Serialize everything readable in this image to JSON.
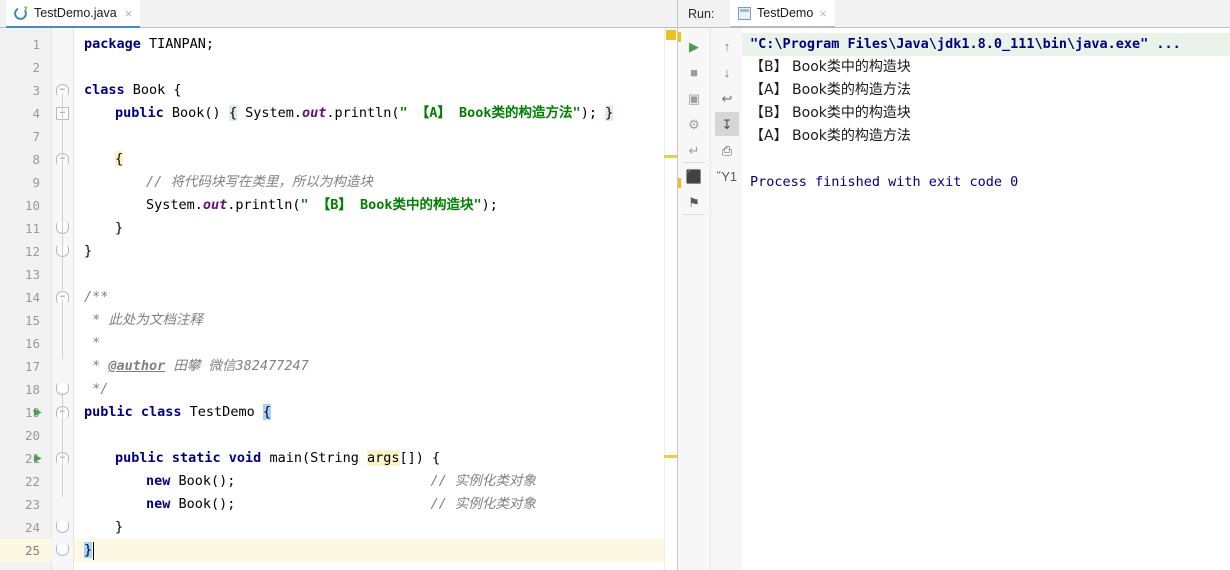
{
  "editor": {
    "tab": {
      "label": "TestDemo.java",
      "icon": "java-class-icon",
      "close": "×"
    },
    "lines": [
      {
        "num": "1",
        "indent": 0,
        "fold": "",
        "run": false,
        "tokens": [
          {
            "t": "package",
            "c": "kw"
          },
          {
            "t": " TIANPAN;",
            "c": "plain"
          }
        ]
      },
      {
        "num": "2",
        "indent": 0,
        "fold": "",
        "run": false,
        "tokens": []
      },
      {
        "num": "3",
        "indent": 0,
        "fold": "start",
        "run": false,
        "tokens": [
          {
            "t": "class",
            "c": "kw"
          },
          {
            "t": " Book ",
            "c": "plain"
          },
          {
            "t": "{",
            "c": "plain"
          }
        ]
      },
      {
        "num": "4",
        "indent": 1,
        "fold": "plus",
        "run": false,
        "tokens": [
          {
            "t": "public",
            "c": "kw"
          },
          {
            "t": " Book() ",
            "c": "plain"
          },
          {
            "t": "{",
            "c": "brhl"
          },
          {
            "t": " System.",
            "c": "plain"
          },
          {
            "t": "out",
            "c": "fld"
          },
          {
            "t": ".println(",
            "c": "plain"
          },
          {
            "t": "\" 【A】 Book类的构造方法\"",
            "c": "str"
          },
          {
            "t": "); ",
            "c": "plain"
          },
          {
            "t": "}",
            "c": "brhl"
          }
        ]
      },
      {
        "num": "7",
        "indent": 0,
        "fold": "",
        "run": false,
        "tokens": []
      },
      {
        "num": "8",
        "indent": 1,
        "fold": "start",
        "run": false,
        "tokens": [
          {
            "t": "{",
            "c": "argshl"
          }
        ]
      },
      {
        "num": "9",
        "indent": 2,
        "fold": "",
        "run": false,
        "tokens": [
          {
            "t": "// 将代码块写在类里，所以为构造块",
            "c": "cmt"
          }
        ]
      },
      {
        "num": "10",
        "indent": 2,
        "fold": "",
        "run": false,
        "tokens": [
          {
            "t": "System.",
            "c": "plain"
          },
          {
            "t": "out",
            "c": "fld"
          },
          {
            "t": ".println(",
            "c": "plain"
          },
          {
            "t": "\" 【B】 Book类中的构造块\"",
            "c": "str"
          },
          {
            "t": ");",
            "c": "plain"
          }
        ]
      },
      {
        "num": "11",
        "indent": 1,
        "fold": "end",
        "run": false,
        "tokens": [
          {
            "t": "}",
            "c": "plain"
          }
        ]
      },
      {
        "num": "12",
        "indent": 0,
        "fold": "end",
        "run": false,
        "tokens": [
          {
            "t": "}",
            "c": "plain"
          }
        ]
      },
      {
        "num": "13",
        "indent": 0,
        "fold": "",
        "run": false,
        "tokens": []
      },
      {
        "num": "14",
        "indent": 0,
        "fold": "start",
        "run": false,
        "tokens": [
          {
            "t": "/**",
            "c": "doc"
          }
        ]
      },
      {
        "num": "15",
        "indent": 0,
        "fold": "",
        "run": false,
        "tokens": [
          {
            "t": " * 此处为文档注释",
            "c": "doc"
          }
        ]
      },
      {
        "num": "16",
        "indent": 0,
        "fold": "",
        "run": false,
        "tokens": [
          {
            "t": " *",
            "c": "doc"
          }
        ]
      },
      {
        "num": "17",
        "indent": 0,
        "fold": "",
        "run": false,
        "tokens": [
          {
            "t": " * ",
            "c": "doc"
          },
          {
            "t": "@author",
            "c": "docTag"
          },
          {
            "t": " 田攀 微信382477247",
            "c": "doc"
          }
        ]
      },
      {
        "num": "18",
        "indent": 0,
        "fold": "end",
        "run": false,
        "tokens": [
          {
            "t": " */",
            "c": "doc"
          }
        ]
      },
      {
        "num": "19",
        "indent": 0,
        "fold": "start",
        "run": true,
        "tokens": [
          {
            "t": "public class",
            "c": "kw"
          },
          {
            "t": " TestDemo ",
            "c": "plain"
          },
          {
            "t": "{",
            "c": "selbr"
          }
        ]
      },
      {
        "num": "20",
        "indent": 0,
        "fold": "",
        "run": false,
        "tokens": []
      },
      {
        "num": "21",
        "indent": 1,
        "fold": "start",
        "run": true,
        "tokens": [
          {
            "t": "public static void",
            "c": "kw"
          },
          {
            "t": " main(String ",
            "c": "plain"
          },
          {
            "t": "args",
            "c": "argshl"
          },
          {
            "t": "[]) {",
            "c": "plain"
          }
        ]
      },
      {
        "num": "22",
        "indent": 2,
        "fold": "",
        "run": false,
        "tokens": [
          {
            "t": "new",
            "c": "kw"
          },
          {
            "t": " Book();",
            "c": "plain"
          },
          {
            "t": "                        ",
            "c": "plain"
          },
          {
            "t": "// 实例化类对象",
            "c": "cmt"
          }
        ]
      },
      {
        "num": "23",
        "indent": 2,
        "fold": "",
        "run": false,
        "tokens": [
          {
            "t": "new",
            "c": "kw"
          },
          {
            "t": " Book();",
            "c": "plain"
          },
          {
            "t": "                        ",
            "c": "plain"
          },
          {
            "t": "// 实例化类对象",
            "c": "cmt"
          }
        ]
      },
      {
        "num": "24",
        "indent": 1,
        "fold": "end",
        "run": false,
        "tokens": [
          {
            "t": "}",
            "c": "plain"
          }
        ]
      },
      {
        "num": "25",
        "indent": 0,
        "fold": "end",
        "run": false,
        "current": true,
        "tokens": [
          {
            "t": "}",
            "c": "selbr"
          }
        ]
      }
    ],
    "markers": {
      "top_color": "#f0c020",
      "stripe_color": "#e8cf4a",
      "stripes_y": [
        155,
        455
      ]
    }
  },
  "run_panel": {
    "title": "Run:",
    "tab": {
      "label": "TestDemo",
      "icon": "run-config-icon",
      "close": "×"
    },
    "toolbar_left": [
      {
        "name": "rerun-icon",
        "glyph": "▶",
        "color": "#4a9e4a",
        "active": false
      },
      {
        "name": "stop-icon",
        "glyph": "■",
        "color": "#9e9e9e",
        "active": false
      },
      {
        "name": "dump-threads-icon",
        "glyph": "▣",
        "color": "#9e9e9e",
        "active": false
      },
      {
        "name": "attach-debug-icon",
        "glyph": "⚙",
        "color": "#9e9e9e",
        "active": false
      },
      {
        "name": "export-icon",
        "glyph": "↵",
        "color": "#9e9e9e",
        "active": false
      },
      {
        "name": "layout-icon",
        "glyph": "⬛",
        "color": "#8a8a8a",
        "active": false
      },
      {
        "name": "pin-icon",
        "glyph": "⚑",
        "color": "#5a5a5a",
        "active": false
      }
    ],
    "toolbar_right": [
      {
        "name": "up-arrow-icon",
        "glyph": "↑",
        "color": "#7a7a7a",
        "active": false
      },
      {
        "name": "down-arrow-icon",
        "glyph": "↓",
        "color": "#7a7a7a",
        "active": false
      },
      {
        "name": "soft-wrap-icon",
        "glyph": "↩",
        "color": "#6e6e6e",
        "active": false
      },
      {
        "name": "scroll-to-end-icon",
        "glyph": "↧",
        "color": "#4a4a4a",
        "active": true
      },
      {
        "name": "print-icon",
        "glyph": "⎙",
        "color": "#5a5a5a",
        "active": false
      },
      {
        "name": "clear-all-icon",
        "glyph": "Ὕ1",
        "color": "#5a5a5a",
        "active": false
      }
    ],
    "console_lines": [
      {
        "text": "\"C:\\Program Files\\Java\\jdk1.8.0_111\\bin\\java.exe\" ...",
        "style": "cmdbg"
      },
      {
        "text": "【B】 Book类中的构造块",
        "style": "out"
      },
      {
        "text": "【A】 Book类的构造方法",
        "style": "out"
      },
      {
        "text": "【B】 Book类中的构造块",
        "style": "out"
      },
      {
        "text": "【A】 Book类的构造方法",
        "style": "out"
      },
      {
        "text": "",
        "style": "out"
      },
      {
        "text": "Process finished with exit code 0",
        "style": "fin"
      }
    ]
  }
}
